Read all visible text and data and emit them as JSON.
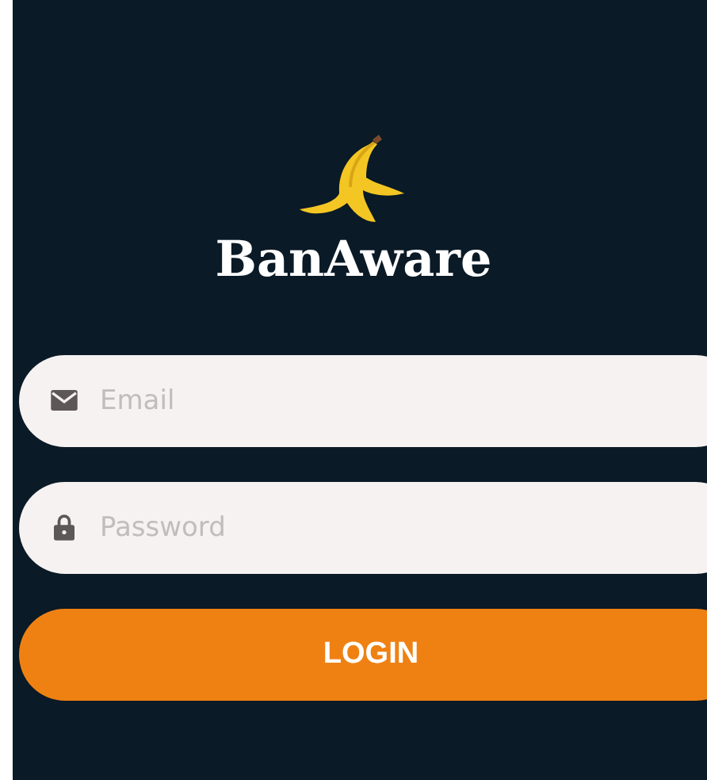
{
  "logo": {
    "title": "BanAware"
  },
  "fields": [
    {
      "kind": "email",
      "placeholder": "Email"
    },
    {
      "kind": "password",
      "placeholder": "Password"
    }
  ],
  "login_button": {
    "label": "LOGIN"
  }
}
